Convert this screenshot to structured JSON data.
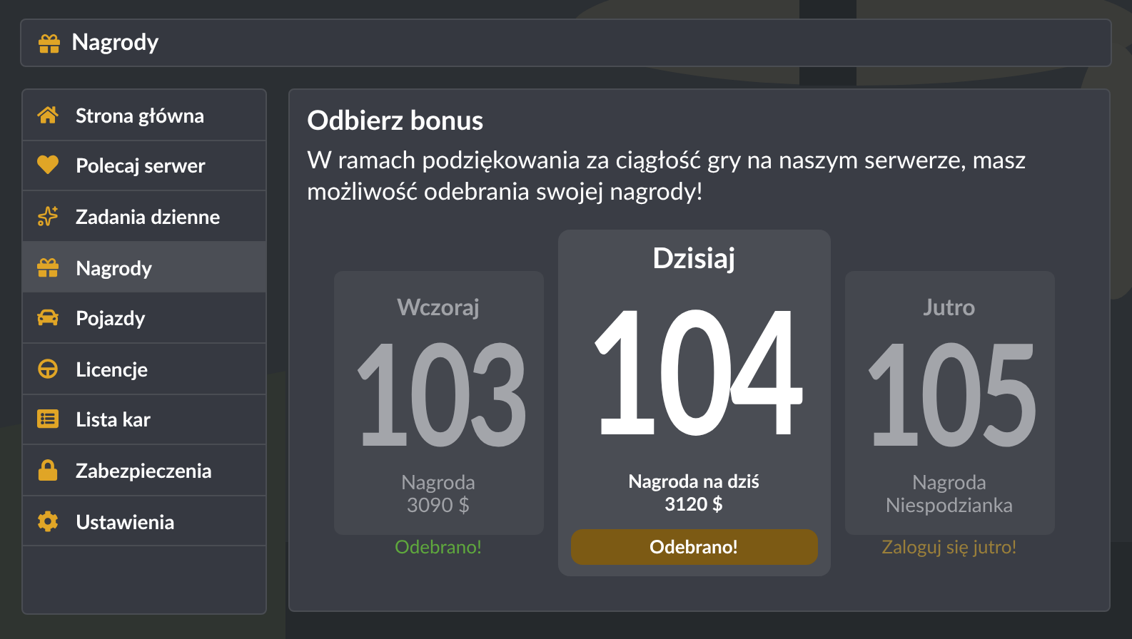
{
  "header": {
    "title": "Nagrody"
  },
  "sidebar": {
    "items": [
      {
        "label": "Strona główna",
        "selected": false
      },
      {
        "label": "Polecaj serwer",
        "selected": false
      },
      {
        "label": "Zadania dzienne",
        "selected": false
      },
      {
        "label": "Nagrody",
        "selected": true
      },
      {
        "label": "Pojazdy",
        "selected": false
      },
      {
        "label": "Licencje",
        "selected": false
      },
      {
        "label": "Lista kar",
        "selected": false
      },
      {
        "label": "Zabezpieczenia",
        "selected": false
      },
      {
        "label": "Ustawienia",
        "selected": false
      }
    ]
  },
  "main": {
    "title": "Odbierz bonus",
    "text": "W ramach podziękowania za ciągłość gry na naszym serwerze, masz możliwość odebrania swojej nagrody!",
    "cards": [
      {
        "kind": "past",
        "day": "Wczoraj",
        "number": "103",
        "reward_label": "Nagroda",
        "reward": "3090 $",
        "status": "Odebrano!"
      },
      {
        "kind": "today",
        "day": "Dzisiaj",
        "number": "104",
        "reward_label": "Nagroda na dziś",
        "reward": "3120 $",
        "status": "Odebrano!"
      },
      {
        "kind": "future",
        "day": "Jutro",
        "number": "105",
        "reward_label": "Nagroda",
        "reward": "Niespodzianka",
        "status": "Zaloguj się jutro!"
      }
    ]
  }
}
